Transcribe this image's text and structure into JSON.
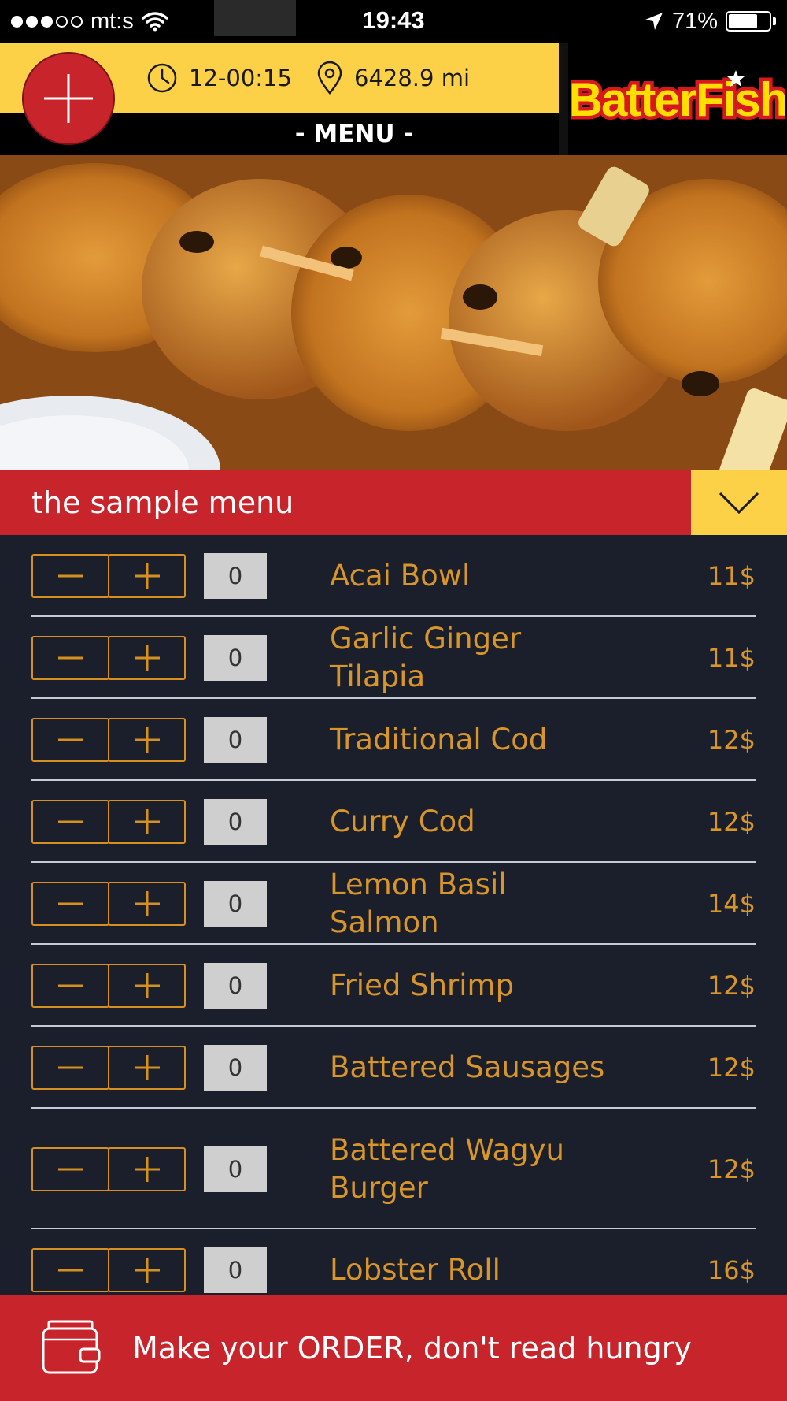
{
  "status_bar": {
    "carrier": "mt:s",
    "time": "19:43",
    "battery_percent": "71%",
    "battery_level": 0.71,
    "signal_bars_filled": 3,
    "signal_bars_total": 5
  },
  "header": {
    "time_value": "12-00:15",
    "distance_value": "6428.9 mi",
    "menu_label": "- MENU -",
    "logo_text": "BatterFish"
  },
  "section": {
    "title": "the sample menu"
  },
  "menu_items": [
    {
      "name": "Acai Bowl",
      "price": "11$",
      "qty": "0"
    },
    {
      "name": "Garlic Ginger Tilapia",
      "price": "11$",
      "qty": "0"
    },
    {
      "name": "Traditional Cod",
      "price": "12$",
      "qty": "0"
    },
    {
      "name": "Curry Cod",
      "price": "12$",
      "qty": "0"
    },
    {
      "name": "Lemon Basil Salmon",
      "price": "14$",
      "qty": "0"
    },
    {
      "name": "Fried Shrimp",
      "price": "12$",
      "qty": "0"
    },
    {
      "name": "Battered Sausages",
      "price": "12$",
      "qty": "0"
    },
    {
      "name": "Battered Wagyu Burger",
      "price": "12$",
      "qty": "0"
    },
    {
      "name": "Lobster Roll",
      "price": "16$",
      "qty": "0"
    }
  ],
  "order_bar": {
    "label": "Make your ORDER, don't read hungry"
  },
  "colors": {
    "brand_red": "#c8242b",
    "brand_yellow": "#fcd147",
    "accent_orange": "#d8952a",
    "list_background": "#1a1f2b"
  },
  "icons": {
    "add": "plus-icon",
    "clock": "clock-icon",
    "location": "location-pin-icon",
    "collapse": "chevron-down-icon",
    "order": "wallet-icon",
    "decrement": "minus-icon",
    "increment": "plus-icon"
  }
}
